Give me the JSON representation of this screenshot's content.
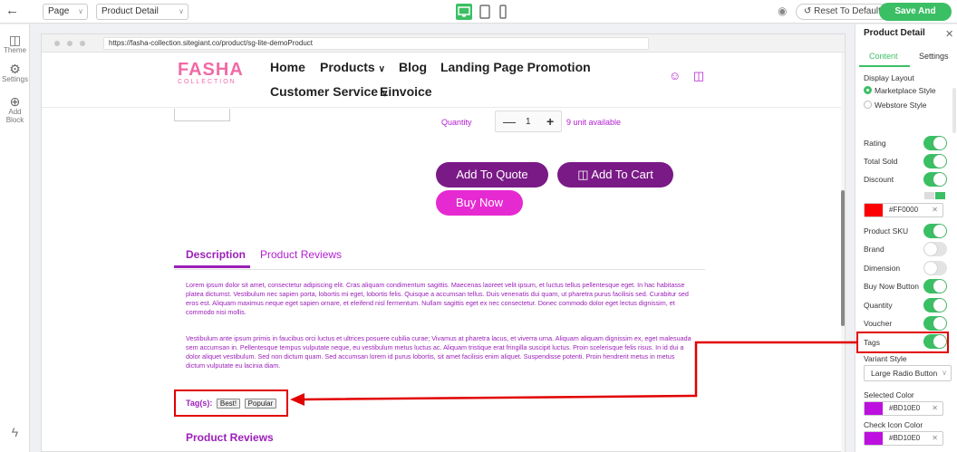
{
  "topbar": {
    "back_icon": "arrow-left-icon",
    "page_select": "Page",
    "detail_select": "Product Detail",
    "reset_label": "Reset To Default",
    "publish_label": "Save And Publish",
    "accent": "#3bbf64"
  },
  "leftbar": {
    "items": [
      {
        "label": "Theme",
        "icon": "layout-icon"
      },
      {
        "label": "Settings",
        "icon": "gear-icon"
      },
      {
        "label": "Add Block",
        "icon": "plus-circle-icon"
      }
    ]
  },
  "browser": {
    "url": "https://fasha-collection.sitegiant.co/product/sg-lite-demoProduct"
  },
  "site": {
    "logo_text": "FASHA",
    "logo_sub": "COLLECTION",
    "nav": {
      "home": "Home",
      "products": "Products",
      "blog": "Blog",
      "landing": "Landing Page Promotion",
      "customer_service": "Customer Service",
      "einvoice": "Einvoice"
    },
    "quantity_label": "Quantity",
    "quantity_value": "1",
    "unit_available": "9 unit available",
    "add_to_quote": "Add To Quote",
    "add_to_cart": "Add To Cart",
    "buy_now": "Buy Now",
    "tab_description": "Description",
    "tab_reviews": "Product Reviews",
    "para1": "Lorem ipsum dolor sit amet, consectetur adipiscing elit. Cras aliquam condimentum sagittis. Maecenas laoreet velit ipsum, et luctus tellus pellentesque eget. In hac habitasse platea dictumst. Vestibulum nec sapien porta, lobortis mi eget, lobortis felis. Quisque a accumsan tellus. Duis venenatis dui quam, ut pharetra purus facilisis sed. Curabitur sed eros est. Aliquam maximus neque eget sapien ornare, et eleifend nisl fermentum. Nullam sagittis eget ex nec consectetur. Donec commodo dolor eget lectus dignissim, et commodo nisi mollis.",
    "para2": "Vestibulum ante ipsum primis in faucibus orci luctus et ultrices posuere cubilia curae; Vivamus at pharetra lacus, et viverra urna. Aliquam aliquam dignissim ex, eget malesuada sem accumsan in. Pellentesque tempus vulputate neque, eu vestibulum metus luctus ac. Aliquam tristique erat fringilla suscipit luctus. Proin scelerisque felis risus. In id dui a dolor aliquet vestibulum. Sed non dictum quam. Sed accumsan lorem id purus lobortis, sit amet facilisis enim aliquet. Suspendisse potenti. Proin hendrerit metus in metus dictum vulputate eu lacinia diam.",
    "tags_label": "Tag(s):",
    "tag1": "Best!",
    "tag2": "Popular",
    "product_reviews_heading": "Product Reviews",
    "brand_color": "#9b1fb8"
  },
  "panel": {
    "title": "Product Detail",
    "tab_content": "Content",
    "tab_settings": "Settings",
    "display_layout": "Display Layout",
    "layout_marketplace": "Marketplace Style",
    "layout_webstore": "Webstore Style",
    "rating": "Rating",
    "total_sold": "Total Sold",
    "discount": "Discount",
    "discount_color": "#FF0000",
    "product_sku": "Product SKU",
    "brand": "Brand",
    "dimension": "Dimension",
    "buy_now_button": "Buy Now Button",
    "quantity": "Quantity",
    "voucher": "Voucher",
    "tags": "Tags",
    "variant_style": "Variant Style",
    "variant_value": "Large Radio Button",
    "selected_color": "Selected Color",
    "selected_color_value": "#BD10E0",
    "check_icon_color": "Check Icon Color",
    "check_icon_color_value": "#BD10E0"
  }
}
